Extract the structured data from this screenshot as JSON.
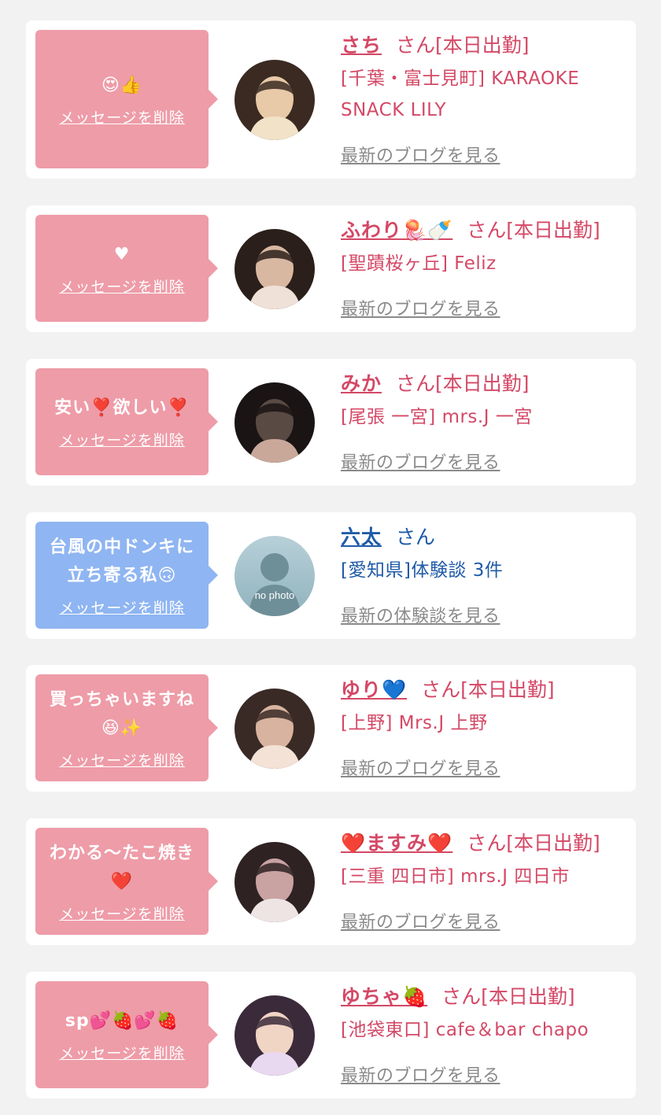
{
  "messages": [
    {
      "message_lines": [
        "😍👍"
      ],
      "delete_label": "メッセージを削除",
      "bubble": "pink",
      "name": "さち",
      "name_suffix": "さん[本日出勤]",
      "shop": "[千葉・富士見町] KARAOKE SNACK LILY",
      "link": "最新のブログを見る",
      "avatar": "photo"
    },
    {
      "message_lines": [
        "♥"
      ],
      "delete_label": "メッセージを削除",
      "bubble": "pink",
      "name": "ふわり🪼🍼",
      "name_suffix": "さん[本日出勤]",
      "shop": "[聖蹟桜ヶ丘] Feliz",
      "link": "最新のブログを見る",
      "avatar": "photo"
    },
    {
      "message_lines": [
        "安い❣️欲しい❣️"
      ],
      "delete_label": "メッセージを削除",
      "bubble": "pink",
      "name": "みか",
      "name_suffix": "さん[本日出勤]",
      "shop": "[尾張 一宮] mrs.J 一宮",
      "link": "最新のブログを見る",
      "avatar": "photo"
    },
    {
      "message_lines": [
        "台風の中ドンキに",
        "立ち寄る私🙃"
      ],
      "delete_label": "メッセージを削除",
      "bubble": "blue",
      "name": "六太",
      "name_suffix": "さん",
      "shop": "[愛知県]体験談 3件",
      "link": "最新の体験談を見る",
      "avatar": "nophoto",
      "avatar_text": "no photo"
    },
    {
      "message_lines": [
        "買っちゃいますね",
        "😆✨"
      ],
      "delete_label": "メッセージを削除",
      "bubble": "pink",
      "name": "ゆり💙",
      "name_suffix": "さん[本日出勤]",
      "shop": "[上野] Mrs.J 上野",
      "link": "最新のブログを見る",
      "avatar": "photo"
    },
    {
      "message_lines": [
        "わかる〜たこ焼き",
        "❤️"
      ],
      "delete_label": "メッセージを削除",
      "bubble": "pink",
      "name": "❤️ますみ❤️",
      "name_suffix": "さん[本日出勤]",
      "shop": "[三重 四日市] mrs.J 四日市",
      "link": "最新のブログを見る",
      "avatar": "photo"
    },
    {
      "message_lines": [
        "sp💕🍓💕🍓"
      ],
      "delete_label": "メッセージを削除",
      "bubble": "pink",
      "name": "ゆちゃ🍓",
      "name_suffix": "さん[本日出勤]",
      "shop": "[池袋東口] cafe＆bar chapo",
      "link": "最新のブログを見る",
      "avatar": "photo"
    }
  ],
  "colors": {
    "page_bg": "#f2f2f2",
    "bubble_pink": "#ee9ca8",
    "bubble_blue": "#8fb5f2",
    "cast_text": "#d44866",
    "member_text": "#1f5ba8",
    "link_gray": "#8a8a8a"
  }
}
